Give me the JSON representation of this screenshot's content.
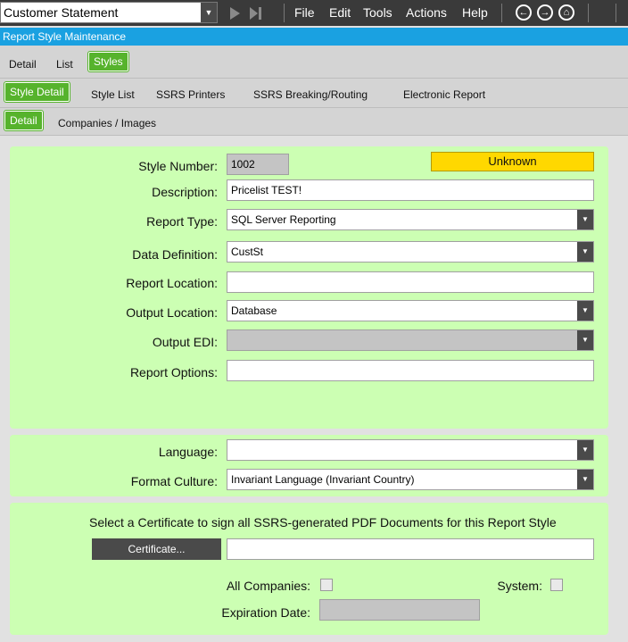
{
  "toolbar": {
    "form_select_value": "Customer Statement",
    "menu": [
      "File",
      "Edit",
      "Tools",
      "Actions",
      "Help"
    ]
  },
  "window_title": "Report Style Maintenance",
  "tabs_level1": [
    "Detail",
    "List",
    "Styles"
  ],
  "tabs_level2": [
    "Style Detail",
    "Style List",
    "SSRS Printers",
    "SSRS Breaking/Routing",
    "Electronic Report"
  ],
  "tabs_level3": [
    "Detail",
    "Companies / Images"
  ],
  "form": {
    "style_number_label": "Style Number:",
    "style_number_value": "1002",
    "status_badge": "Unknown",
    "description_label": "Description:",
    "description_value": "Pricelist TEST!",
    "report_type_label": "Report Type:",
    "report_type_value": "SQL Server Reporting",
    "data_definition_label": "Data Definition:",
    "data_definition_value": "CustSt",
    "report_location_label": "Report Location:",
    "report_location_value": "",
    "output_location_label": "Output Location:",
    "output_location_value": "Database",
    "output_edi_label": "Output EDI:",
    "output_edi_value": "",
    "report_options_label": "Report Options:",
    "report_options_value": ""
  },
  "language": {
    "language_label": "Language:",
    "language_value": "",
    "format_culture_label": "Format Culture:",
    "format_culture_value": "Invariant Language (Invariant Country)"
  },
  "certificate": {
    "instruction": "Select a Certificate to sign all SSRS-generated PDF Documents for this Report Style",
    "button_label": "Certificate...",
    "certificate_value": "",
    "all_companies_label": "All Companies:",
    "system_label": "System:",
    "expiration_label": "Expiration Date:",
    "expiration_value": ""
  },
  "colors": {
    "accent_green": "#56b32c",
    "panel_green": "#ccffb3",
    "title_blue": "#1aa1e1",
    "status_yellow": "#ffd800"
  }
}
